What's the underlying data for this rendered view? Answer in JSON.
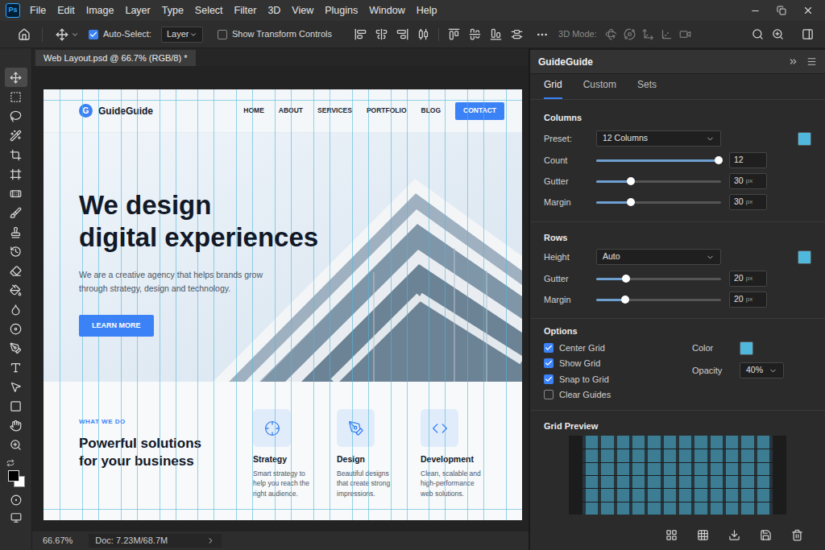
{
  "app": {
    "logo": "Ps"
  },
  "menu": [
    "File",
    "Edit",
    "Image",
    "Layer",
    "Type",
    "Select",
    "Filter",
    "3D",
    "View",
    "Plugins",
    "Window",
    "Help"
  ],
  "options_bar": {
    "auto_select": {
      "label": "Auto-Select:",
      "checked": true
    },
    "target": "Layer",
    "transform_controls": {
      "label": "Show Transform Controls",
      "checked": false
    },
    "mode_label": "3D Mode:"
  },
  "tools": [
    {
      "kind": "move",
      "selected": true
    },
    {
      "kind": "marquee",
      "selected": false
    },
    {
      "kind": "lasso",
      "selected": false
    },
    {
      "kind": "quick-select",
      "selected": false
    },
    {
      "kind": "crop",
      "selected": false
    },
    {
      "kind": "frame",
      "selected": false
    },
    {
      "kind": "healing",
      "selected": false
    },
    {
      "kind": "brush",
      "selected": false
    },
    {
      "kind": "stamp",
      "selected": false
    },
    {
      "kind": "history",
      "selected": false
    },
    {
      "kind": "eraser",
      "selected": false
    },
    {
      "kind": "gradient",
      "selected": false
    },
    {
      "kind": "blur",
      "selected": false
    },
    {
      "kind": "dodge",
      "selected": false
    },
    {
      "kind": "pen",
      "selected": false
    },
    {
      "kind": "type",
      "selected": false
    },
    {
      "kind": "path",
      "selected": false
    },
    {
      "kind": "shape",
      "selected": false
    },
    {
      "kind": "hand",
      "selected": false
    },
    {
      "kind": "zoom",
      "selected": false
    }
  ],
  "document": {
    "tab": "Web Layout.psd @ 66.7% (RGB/8) *",
    "zoom": "66.67%",
    "doc_info": "Doc: 7.23M/68.7M"
  },
  "webpage": {
    "logo_mark": "G",
    "brand": "GuideGuide",
    "nav": [
      {
        "label": "HOME",
        "selected": false
      },
      {
        "label": "ABOUT",
        "selected": false
      },
      {
        "label": "SERVICES",
        "selected": false
      },
      {
        "label": "PORTFOLIO",
        "selected": false
      },
      {
        "label": "BLOG",
        "selected": false
      },
      {
        "label": "CONTACT",
        "selected": true
      }
    ],
    "hero": {
      "title_lines": [
        "We design",
        "digital experiences"
      ],
      "subtitle_lines": [
        "We are a creative agency that helps brands grow",
        "through strategy, design and technology."
      ],
      "button": "LEARN MORE"
    },
    "services": {
      "eyebrow": "WHAT WE DO",
      "title_lines": [
        "Powerful solutions",
        "for your business"
      ],
      "items": [
        {
          "kind": "target",
          "title": "Strategy",
          "lines": [
            "Smart strategy to",
            "help you reach the",
            "right audience."
          ]
        },
        {
          "kind": "pen",
          "title": "Design",
          "lines": [
            "Beautiful designs",
            "that create strong",
            "impressions."
          ]
        },
        {
          "kind": "code",
          "title": "Development",
          "lines": [
            "Clean, scalable and",
            "high-performance",
            "web solutions."
          ]
        }
      ]
    }
  },
  "panel": {
    "title": "GuideGuide",
    "tabs": [
      {
        "label": "Grid",
        "selected": true
      },
      {
        "label": "Custom",
        "selected": false
      },
      {
        "label": "Sets",
        "selected": false
      }
    ],
    "columns": {
      "title": "Columns",
      "preset": {
        "label": "Preset:",
        "value": "12 Columns"
      },
      "color": "#4fb8dc",
      "sliders": [
        {
          "label": "Count",
          "level": 0.98,
          "value": "12",
          "unit": ""
        },
        {
          "label": "Gutter",
          "level": 0.28,
          "value": "30",
          "unit": "px"
        },
        {
          "label": "Margin",
          "level": 0.28,
          "value": "30",
          "unit": "px"
        }
      ]
    },
    "rows": {
      "title": "Rows",
      "height": {
        "label": "Height",
        "value": "Auto"
      },
      "color": "#4fb8dc",
      "sliders": [
        {
          "label": "Gutter",
          "level": 0.24,
          "value": "20",
          "unit": "px"
        },
        {
          "label": "Margin",
          "level": 0.23,
          "value": "20",
          "unit": "px"
        }
      ]
    },
    "options": {
      "title": "Options",
      "checks": [
        {
          "label": "Center Grid",
          "checked": true
        },
        {
          "label": "Show Grid",
          "checked": true
        },
        {
          "label": "Snap to Grid",
          "checked": true
        },
        {
          "label": "Clear Guides",
          "checked": false
        }
      ],
      "color": {
        "label": "Color",
        "value": "#4fb8dc"
      },
      "opacity": {
        "label": "Opacity",
        "value": "40%"
      }
    },
    "preview": {
      "title": "Grid Preview"
    }
  }
}
